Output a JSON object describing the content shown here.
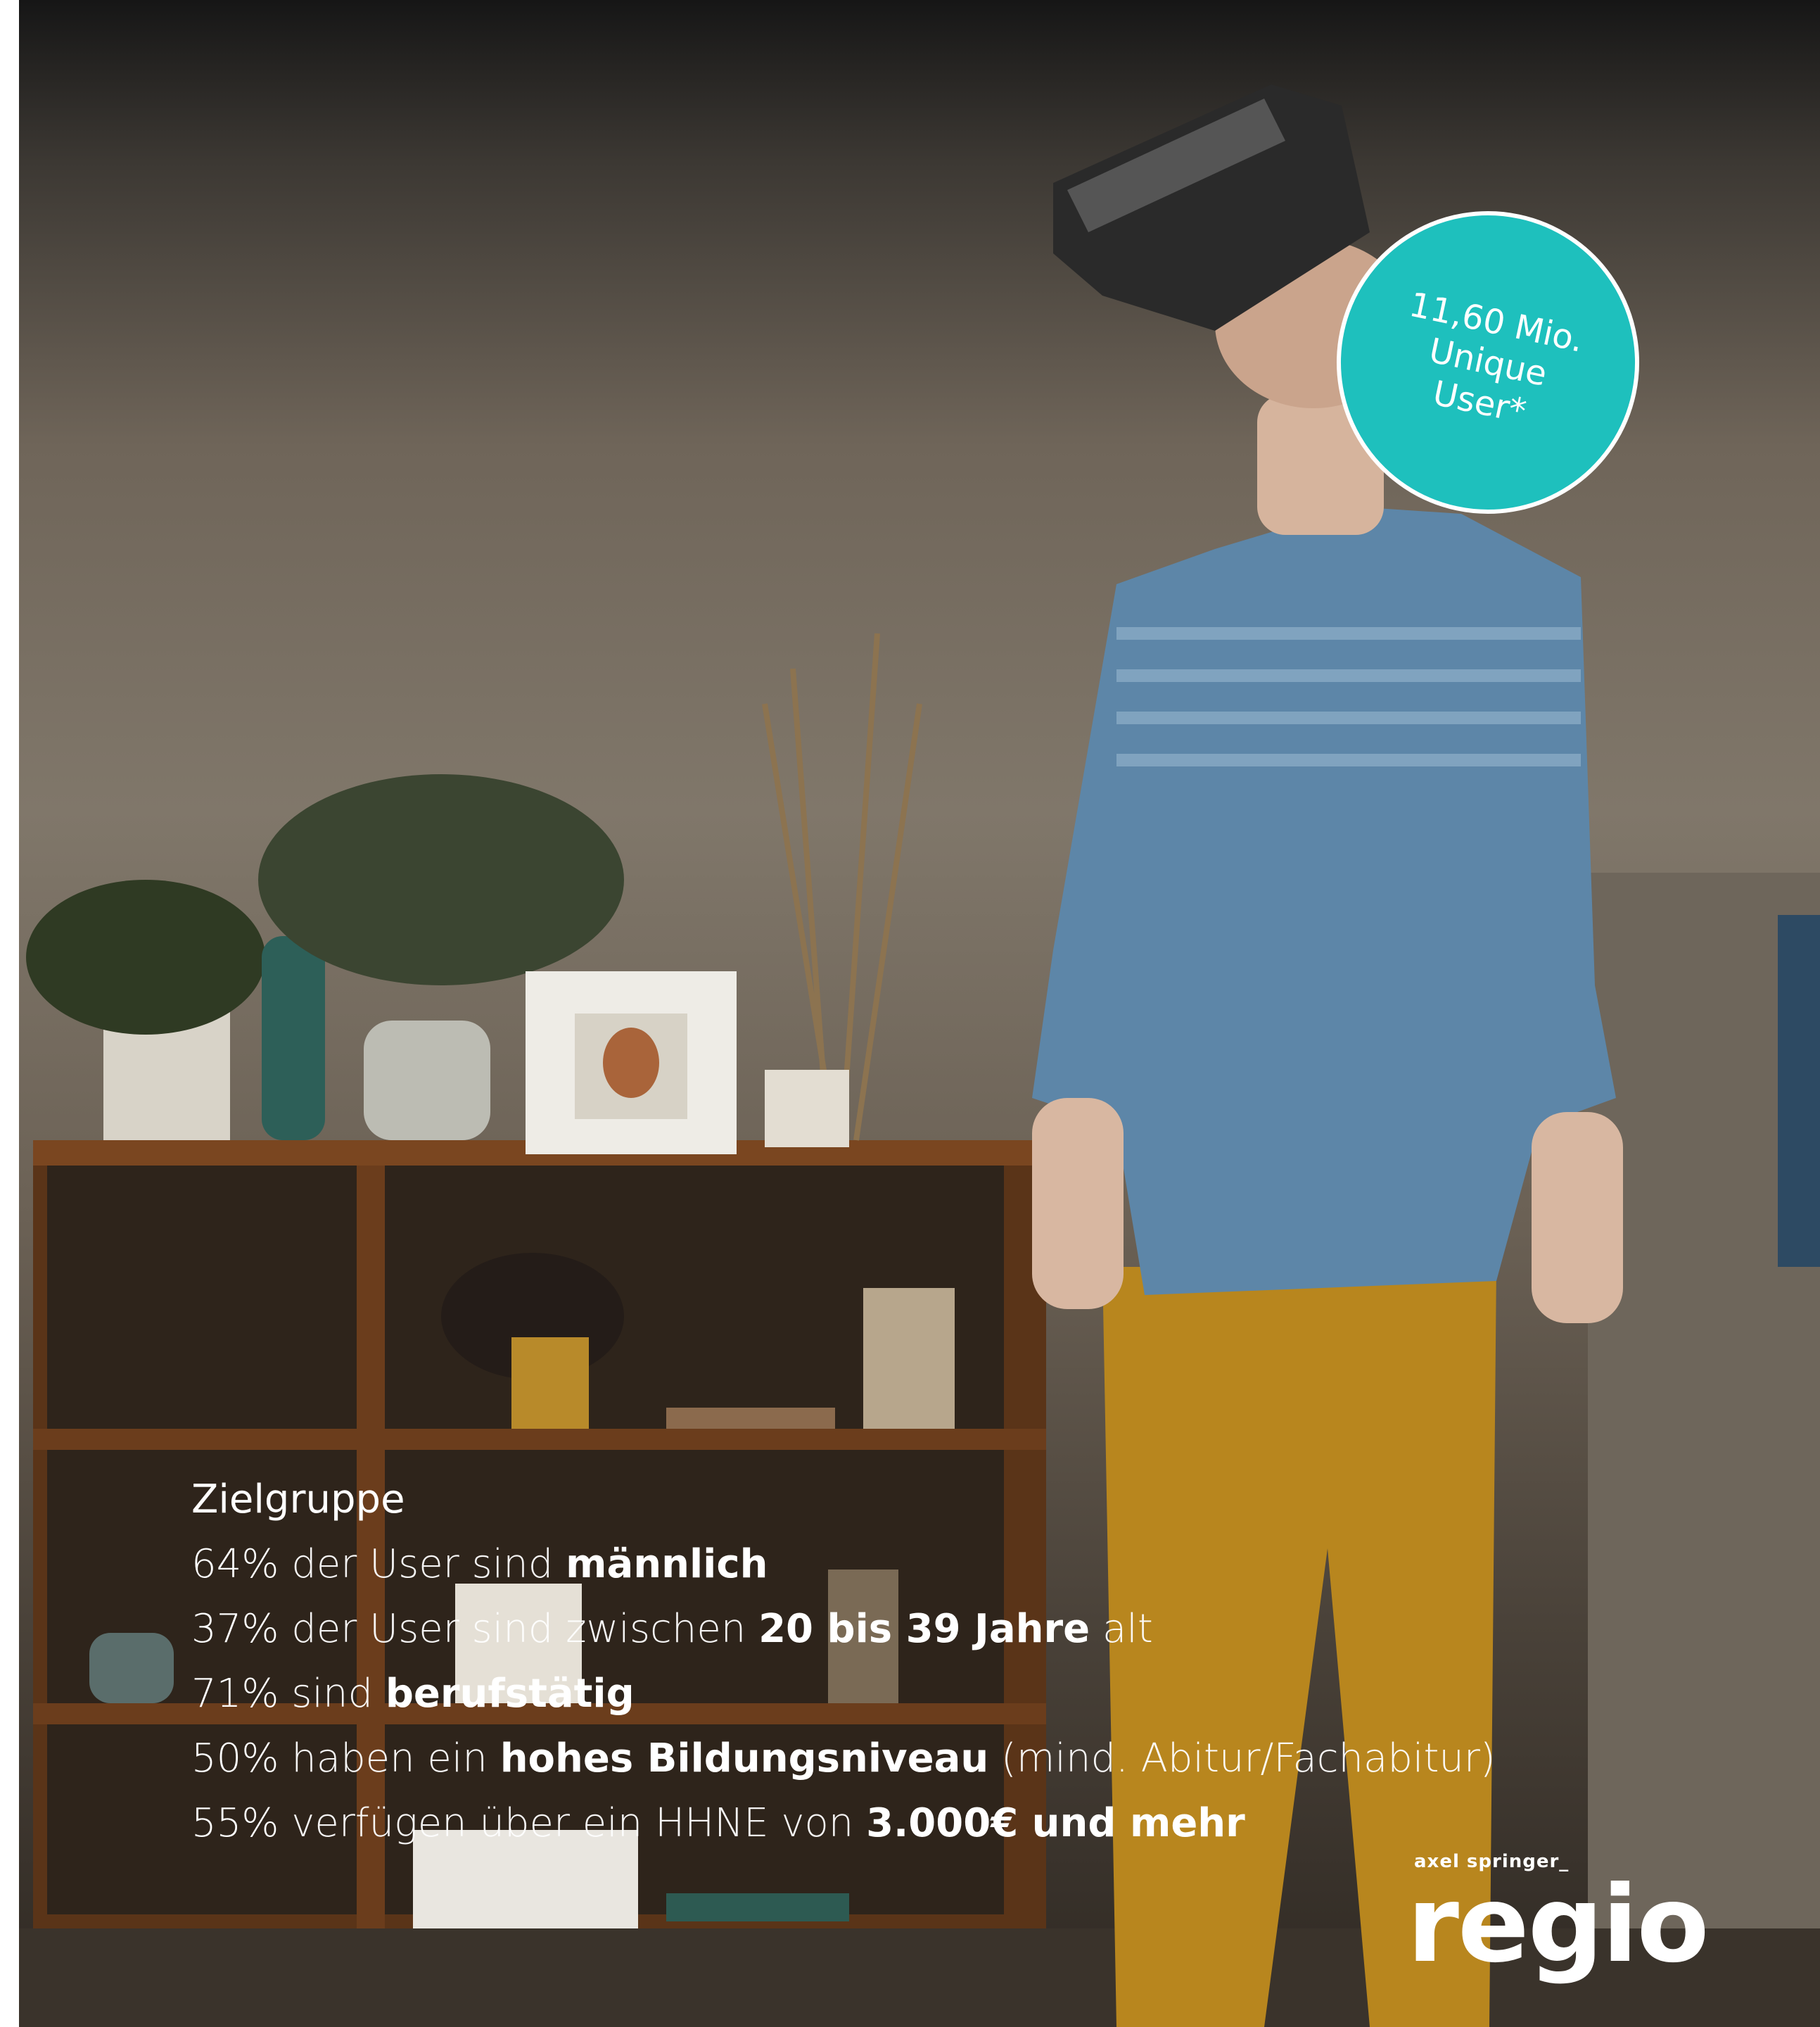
{
  "badge": {
    "line1": "11,60 Mio.",
    "line2": "Unique",
    "line3": "User*",
    "color": "#1ec0bd"
  },
  "stats": {
    "title": "Zielgruppe",
    "lines": [
      {
        "a": "64%",
        "b": " der User sind ",
        "c": "männlich",
        "d": ""
      },
      {
        "a": "37%",
        "b": " der User sind zwischen ",
        "c": "20 bis 39 Jahre",
        "d": " alt"
      },
      {
        "a": "71%",
        "b": " sind ",
        "c": "berufstätig",
        "d": ""
      },
      {
        "a": "50%",
        "b": " haben ein ",
        "c": "hohes Bildungsniveau",
        "d": " (mind. Abitur/Fachabitur)"
      },
      {
        "a": "55%",
        "b": " verfügen über ein HHNE von ",
        "c": "3.000€ und mehr",
        "d": ""
      }
    ]
  },
  "logo": {
    "small": "axel springer_",
    "big": "regio"
  }
}
